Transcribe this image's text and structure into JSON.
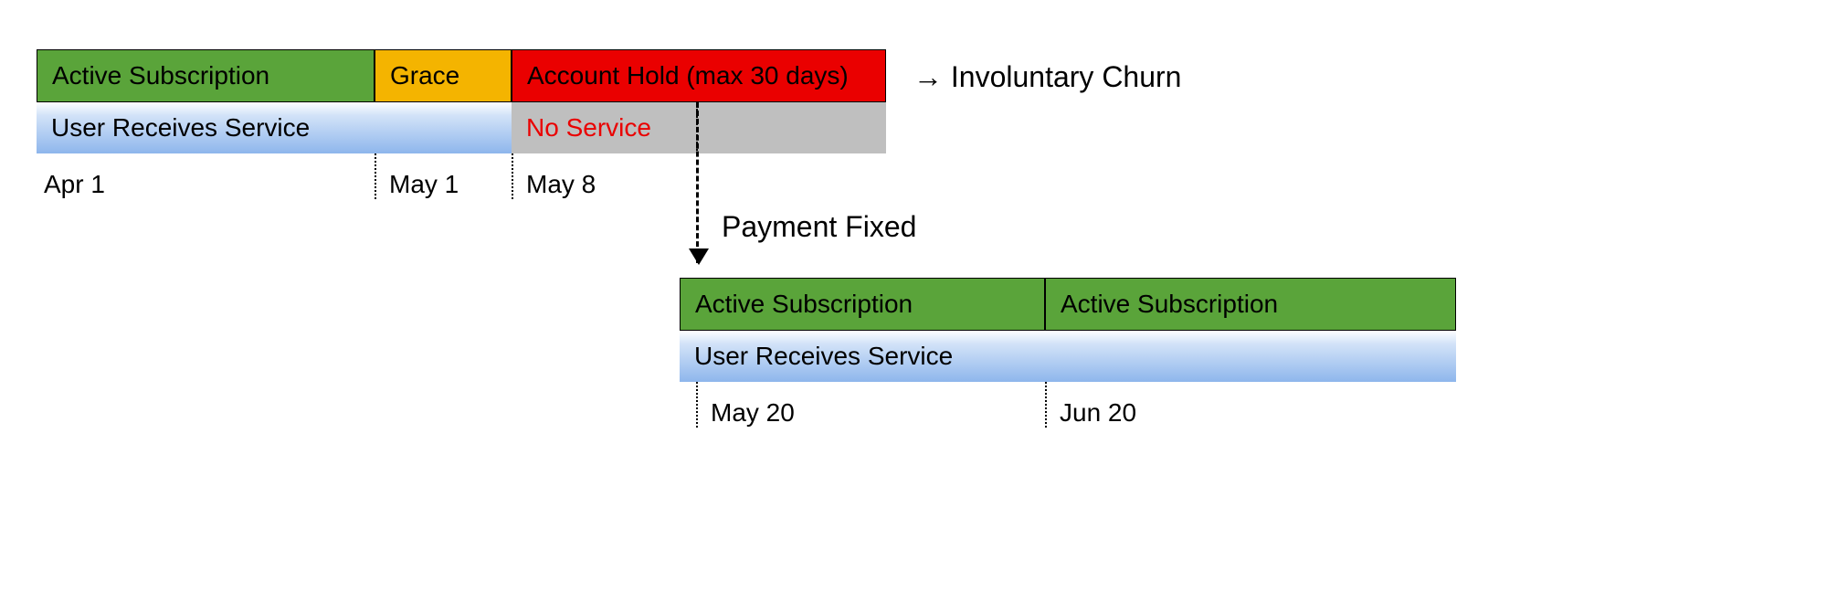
{
  "top": {
    "active_label": "Active Subscription",
    "grace_label": "Grace",
    "hold_label": "Account Hold (max 30 days)",
    "service_label": "User Receives Service",
    "no_service_label": "No Service",
    "date1": "Apr 1",
    "date2": "May 1",
    "date3": "May 8",
    "churn_label": "→ Involuntary Churn"
  },
  "mid": {
    "payment_fixed_label": "Payment Fixed"
  },
  "bottom": {
    "active1_label": "Active Subscription",
    "active2_label": "Active Subscription",
    "service_label": "User Receives Service",
    "date1": "May 20",
    "date2": "Jun 20"
  }
}
